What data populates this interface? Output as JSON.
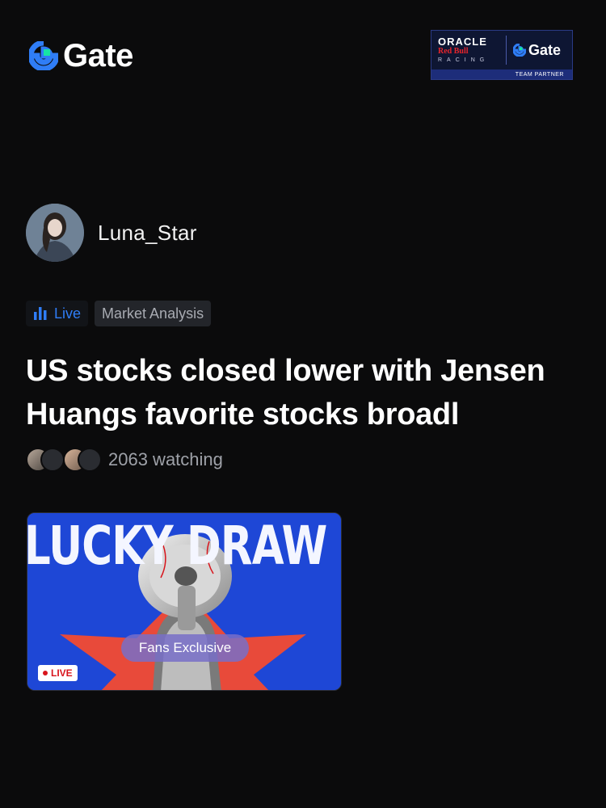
{
  "header": {
    "logo_text": "Gate",
    "partner_badge": {
      "oracle": "ORACLE",
      "redbull": "Red Bull",
      "racing": "RACING",
      "gate": "Gate",
      "caption": "TEAM PARTNER"
    }
  },
  "author": {
    "name": "Luna_Star"
  },
  "tags": {
    "live": "Live",
    "category": "Market Analysis"
  },
  "post": {
    "title": "US stocks closed lower with Jensen Huangs favorite stocks broadl"
  },
  "watching": {
    "count_text": "2063 watching"
  },
  "live_card": {
    "headline": "LUCKY DRAW",
    "pill": "Fans Exclusive",
    "live_badge": "LIVE"
  },
  "colors": {
    "background": "#0b0b0c",
    "accent_blue": "#2f7df6",
    "gate_green": "#17e5a4",
    "card_blue": "#1e47d6",
    "live_red": "#d8141c"
  },
  "icons": [
    "gate-logo-icon",
    "bar-chart-icon",
    "megaphone-image"
  ]
}
